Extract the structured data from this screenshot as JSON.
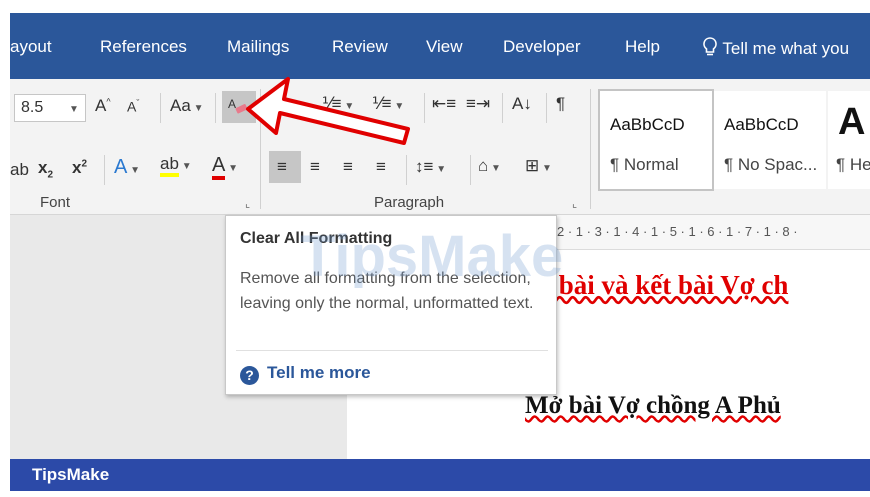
{
  "tabs": [
    "ayout",
    "References",
    "Mailings",
    "Review",
    "View",
    "Developer",
    "Help"
  ],
  "tell_me": "Tell me what you",
  "font": {
    "size_value": "8.5",
    "change_case": "Aa",
    "group_label": "Font"
  },
  "paragraph": {
    "group_label": "Paragraph"
  },
  "styles": [
    {
      "preview": "AaBbCcD",
      "name": "¶ Normal"
    },
    {
      "preview": "AaBbCcD",
      "name": "¶ No Spac..."
    },
    {
      "preview": "A",
      "name": "¶ He"
    }
  ],
  "tooltip": {
    "title": "Clear All Formatting",
    "description": "Remove all formatting from the selection, leaving only the normal, unformatted text.",
    "link": "Tell me more"
  },
  "ruler_text": "2 · 1 · 3 · 1 · 4 · 1 · 5 · 1 · 6 · 1 · 7 · 1 · 8 ·",
  "document": {
    "red_heading": "ở bài và kết bài Vợ ch",
    "heading": "Mở bài Vợ chồng A Phủ"
  },
  "footer_brand": "TipsMake",
  "watermark": "TipsMake",
  "accent_colors": {
    "tabbar": "#2b579a",
    "font_color_red": "#e00000",
    "footer": "#2c4aa8"
  }
}
